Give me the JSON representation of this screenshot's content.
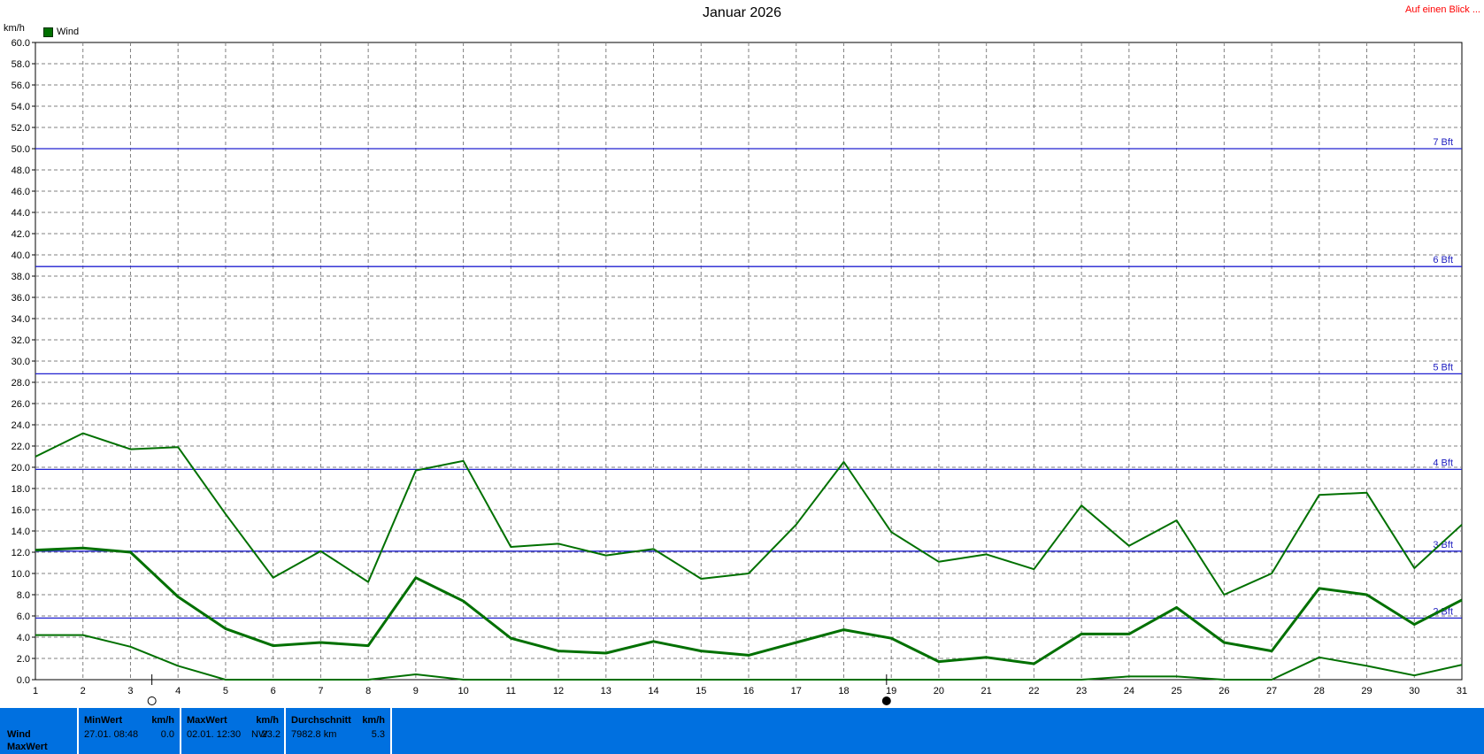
{
  "title": "Januar 2026",
  "link_label": "Auf einen Blick ...",
  "y_unit": "km/h",
  "legend_label": "Wind",
  "colors": {
    "series": "#007000",
    "bft_lines": "#2020d0",
    "link": "#ff0000",
    "stats_bg": "#0070e0"
  },
  "chart_data": {
    "type": "line",
    "title": "Januar 2026",
    "ylabel": "km/h",
    "xlabel": "",
    "x": [
      1,
      2,
      3,
      4,
      5,
      6,
      7,
      8,
      9,
      10,
      11,
      12,
      13,
      14,
      15,
      16,
      17,
      18,
      19,
      20,
      21,
      22,
      23,
      24,
      25,
      26,
      27,
      28,
      29,
      30,
      31
    ],
    "xlim": [
      1,
      31
    ],
    "ylim": [
      0,
      60
    ],
    "ytick_step": 2,
    "grid": true,
    "legend": "top-left",
    "series": [
      {
        "name": "Wind",
        "style": "max",
        "values": [
          21.0,
          23.2,
          21.7,
          21.9,
          15.6,
          9.6,
          12.1,
          9.2,
          19.7,
          20.6,
          12.5,
          12.8,
          11.7,
          12.3,
          9.5,
          10.0,
          14.6,
          20.5,
          13.9,
          11.1,
          11.8,
          10.4,
          16.4,
          12.6,
          15.0,
          8.0,
          10.0,
          17.4,
          17.6,
          10.5,
          14.6
        ]
      },
      {
        "name": "",
        "style": "avg",
        "values": [
          12.2,
          12.4,
          12.0,
          7.8,
          4.8,
          3.2,
          3.5,
          3.2,
          9.6,
          7.4,
          3.9,
          2.7,
          2.5,
          3.6,
          2.7,
          2.3,
          3.5,
          4.7,
          3.9,
          1.7,
          2.1,
          1.5,
          4.3,
          4.3,
          6.8,
          3.5,
          2.7,
          8.6,
          8.0,
          5.2,
          7.5
        ]
      },
      {
        "name": "",
        "style": "min",
        "values": [
          4.2,
          4.2,
          3.1,
          1.3,
          0.0,
          0.0,
          0.0,
          0.0,
          0.5,
          0.0,
          0.0,
          0.0,
          0.0,
          0.0,
          0.0,
          0.0,
          0.0,
          0.0,
          0.0,
          0.0,
          0.0,
          0.0,
          0.0,
          0.3,
          0.3,
          0.0,
          0.0,
          2.1,
          1.3,
          0.4,
          1.4
        ]
      }
    ],
    "reference_lines": [
      {
        "label": "2 Bft",
        "value": 5.8
      },
      {
        "label": "3 Bft",
        "value": 12.1
      },
      {
        "label": "4 Bft",
        "value": 19.8
      },
      {
        "label": "5 Bft",
        "value": 28.8
      },
      {
        "label": "6 Bft",
        "value": 38.9
      },
      {
        "label": "7 Bft",
        "value": 50.0
      }
    ],
    "moon_phases": [
      {
        "day": 3.45,
        "phase": "full-moon"
      },
      {
        "day": 18.9,
        "phase": "new-moon"
      }
    ]
  },
  "stats": {
    "row_labels": [
      "Wind",
      "MaxWert"
    ],
    "min": {
      "header": "MinWert",
      "unit": "km/h",
      "when": "27.01.  08:48",
      "value": "0.0"
    },
    "max": {
      "header": "MaxWert",
      "unit": "km/h",
      "when": "02.01.  12:30",
      "dir": "NW",
      "value": "23.2"
    },
    "avg": {
      "header": "Durchschnitt",
      "unit": "km/h",
      "total": "7982.8 km",
      "value": "5.3"
    }
  }
}
